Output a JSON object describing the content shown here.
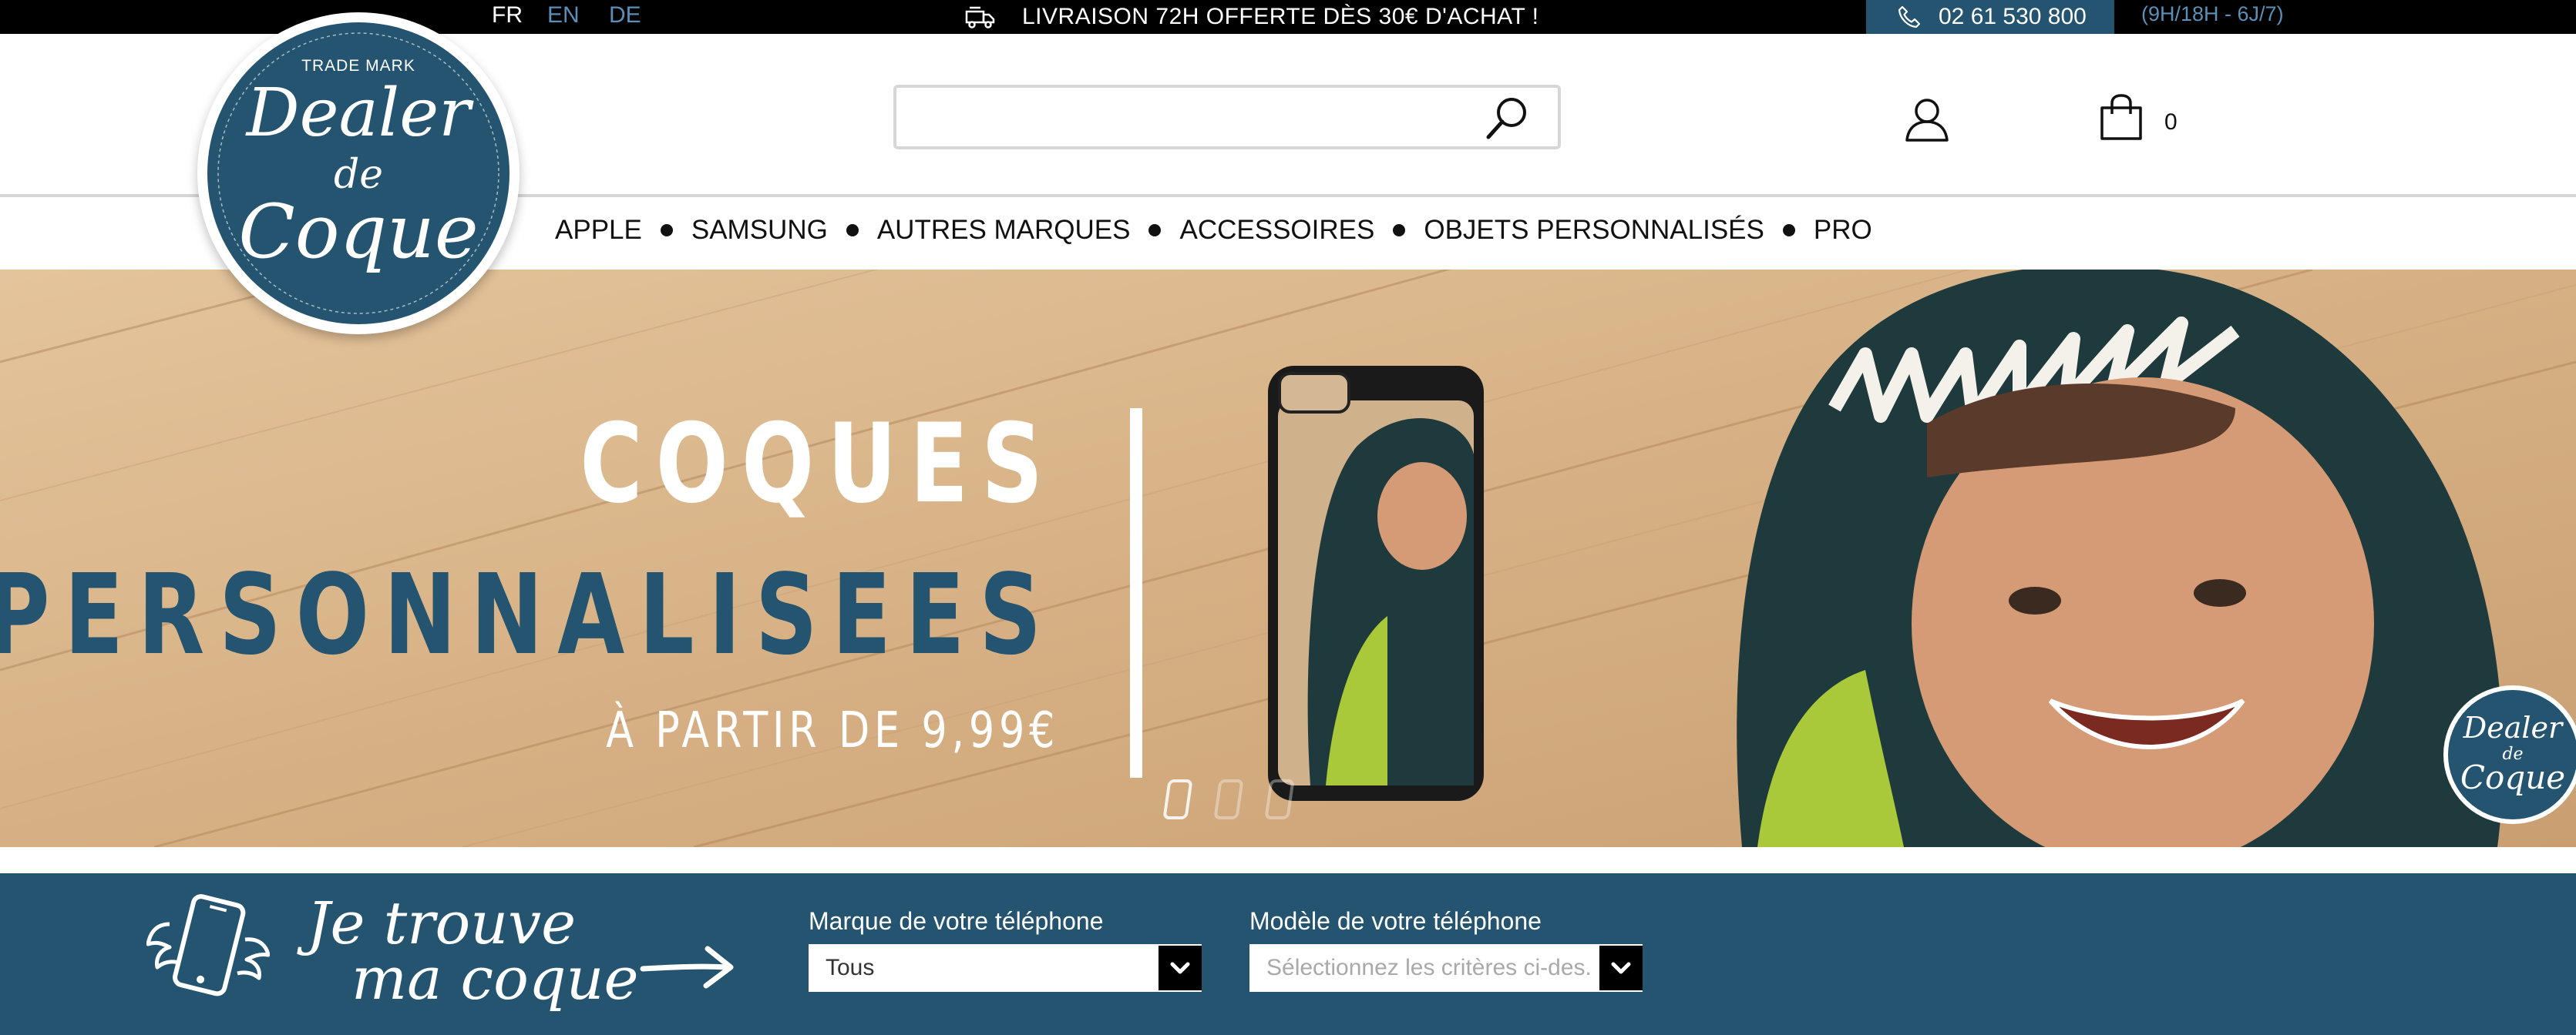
{
  "topbar": {
    "languages": [
      "FR",
      "EN",
      "DE"
    ],
    "promo_text": "LIVRAISON 72H OFFERTE DÈS 30€ D'ACHAT !",
    "phone": "02 61 530 800",
    "hours": "(9H/18H - 6J/7)"
  },
  "logo": {
    "trademark": "TRADE MARK",
    "line1": "Dealer",
    "line2": "de",
    "line3": "Coque"
  },
  "header": {
    "search_value": "",
    "cart_count": "0"
  },
  "nav": {
    "items": [
      "APPLE",
      "SAMSUNG",
      "AUTRES MARQUES",
      "ACCESSOIRES",
      "OBJETS PERSONNALISÉS",
      "PRO"
    ]
  },
  "hero": {
    "headline1": "COQUES",
    "headline2": "PERSONNALISEES",
    "price_text": "À PARTIR DE 9,99€",
    "slides_total": 3,
    "active_slide": 1,
    "mini_logo": {
      "line1": "Dealer",
      "line2": "de",
      "line3": "Coque"
    }
  },
  "finder": {
    "title_line1": "Je trouve",
    "title_line2": "ma coque",
    "brand_label": "Marque de votre téléphone",
    "brand_value": "Tous",
    "model_label": "Modèle de votre téléphone",
    "model_placeholder": "Sélectionnez les critères ci-des..."
  },
  "colors": {
    "brand_blue": "#245470",
    "link_blue": "#5a8fb8",
    "topbar_bg": "#000000",
    "wood": "#d7b48a"
  },
  "icons": [
    "truck-icon",
    "phone-icon",
    "search-icon",
    "user-icon",
    "shopping-bag-icon",
    "winged-phone-icon",
    "arrow-right-icon",
    "chevron-down-icon"
  ]
}
